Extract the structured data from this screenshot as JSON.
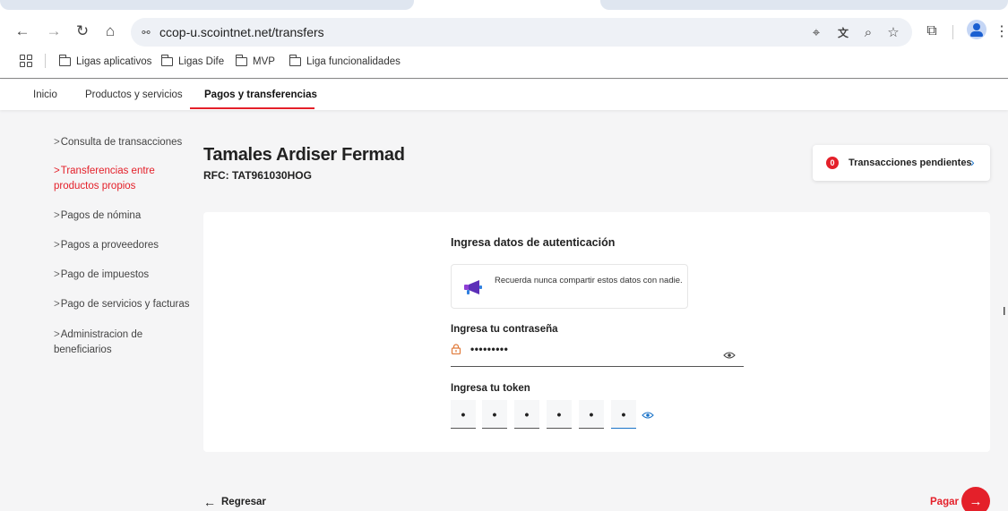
{
  "browser": {
    "url": "ccop-u.scointnet.net/transfers",
    "bookmarks": [
      "Ligas aplicativos",
      "Ligas Dife",
      "MVP",
      "Liga funcionalidades"
    ]
  },
  "nav": {
    "tabs": [
      "Inicio",
      "Productos y servicios",
      "Pagos y transferencias"
    ],
    "active": "Pagos y transferencias"
  },
  "sidebar": {
    "items": [
      {
        "label": "Consulta de transacciones",
        "active": false
      },
      {
        "label": "Transferencias entre productos propios",
        "active": true
      },
      {
        "label": "Pagos de nómina",
        "active": false
      },
      {
        "label": "Pagos a proveedores",
        "active": false
      },
      {
        "label": "Pago de impuestos",
        "active": false
      },
      {
        "label": "Pago de servicios y facturas",
        "active": false
      },
      {
        "label": "Administracion de beneficiarios",
        "active": false
      }
    ]
  },
  "client": {
    "name": "Tamales Ardiser Fermad",
    "rfc": "RFC: TAT961030HOG"
  },
  "pending": {
    "count": "0",
    "label": "Transacciones pendientes"
  },
  "auth": {
    "title": "Ingresa datos de autenticación",
    "notice": "Recuerda nunca compartir estos datos con nadie.",
    "password_label": "Ingresa tu contraseña",
    "password_value": "•••••••••",
    "token_label": "Ingresa tu token",
    "token_digits": [
      "•",
      "•",
      "•",
      "•",
      "•",
      "•"
    ]
  },
  "actions": {
    "back": "Regresar",
    "pay": "Pagar"
  },
  "colors": {
    "brand_red": "#e4202a",
    "link_blue": "#1a73c8"
  }
}
